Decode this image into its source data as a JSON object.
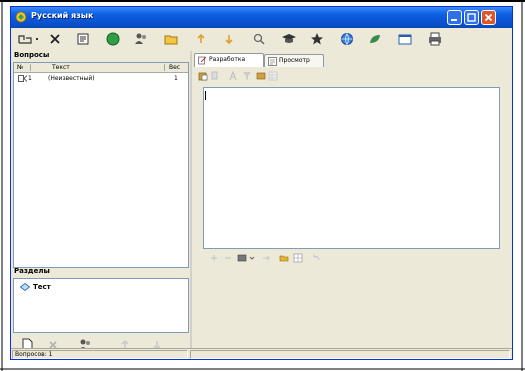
{
  "window": {
    "title": "Русский язык",
    "frame_color": "#0831d9",
    "titlebar_color": "#0a50cd"
  },
  "toolbar": {
    "items": [
      "open-icon",
      "dropdown-arrow-icon",
      "delete-icon",
      "export-icon",
      "status-green-icon",
      "users-icon",
      "folder-open-icon",
      "arrow-up-icon",
      "arrow-down-icon",
      "search-icon",
      "graduation-icon",
      "star-icon",
      "globe-icon",
      "leaf-icon",
      "window-icon",
      "print-icon"
    ]
  },
  "questions": {
    "title": "Вопросы",
    "columns": [
      "№",
      "Текст",
      "Вес"
    ],
    "rows": [
      {
        "num": "1",
        "text": "(Неизвестный)",
        "weight": "1"
      }
    ]
  },
  "sections": {
    "title": "Разделы",
    "nodes": [
      {
        "label": "Тест",
        "icon": "diamond-icon"
      }
    ]
  },
  "tabs": [
    {
      "label": "Разработка",
      "icon": "edit-icon",
      "active": true
    },
    {
      "label": "Просмотр",
      "icon": "preview-icon",
      "active": false
    }
  ],
  "editor": {
    "content": ""
  },
  "status": {
    "text": "Вопросов: 1"
  }
}
